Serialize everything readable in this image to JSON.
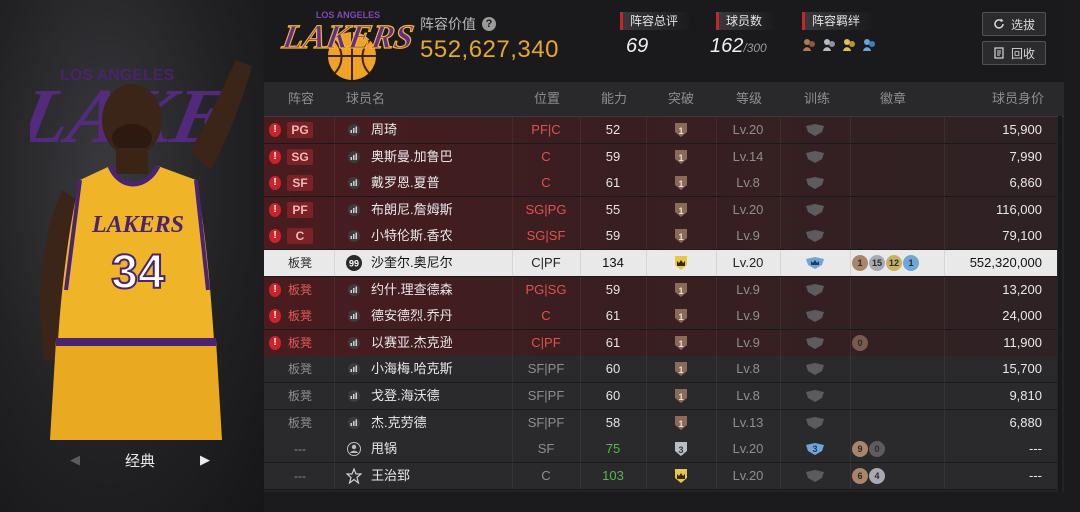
{
  "left_panel": {
    "era_label": "经典",
    "jersey_team": "LAKERS",
    "jersey_number": "34"
  },
  "header": {
    "logo_text_top": "LOS ANGELES",
    "logo_text_main": "LAKERS",
    "value_label": "阵容价值",
    "value_amount": "552,627,340",
    "stats": {
      "overall_label": "阵容总评",
      "overall_value": "69",
      "players_label": "球员数",
      "players_value": "162",
      "players_max": "/300",
      "bonds_label": "阵容羁绊"
    },
    "select_button": "选拔",
    "recycle_button": "回收"
  },
  "columns": {
    "slot": "阵容",
    "name": "球员名",
    "position": "位置",
    "rating": "能力",
    "breakthrough": "突破",
    "level": "等级",
    "training": "训练",
    "badges": "徽章",
    "price": "球员身价"
  },
  "rows": [
    {
      "warn": true,
      "slot": "PG",
      "slot_style": "badge",
      "icon": "bars",
      "name": "周琦",
      "pos": "PF|C",
      "rating": "52",
      "rating_color": "normal",
      "break": "1",
      "break_type": "brown",
      "level": "Lv.20",
      "train": "gray",
      "badges": [],
      "price": "15,900"
    },
    {
      "warn": true,
      "slot": "SG",
      "slot_style": "badge",
      "icon": "bars",
      "name": "奥斯曼.加鲁巴",
      "pos": "C",
      "rating": "59",
      "rating_color": "normal",
      "break": "1",
      "break_type": "brown",
      "level": "Lv.14",
      "train": "gray",
      "badges": [],
      "price": "7,990"
    },
    {
      "warn": true,
      "slot": "SF",
      "slot_style": "badge",
      "icon": "bars",
      "name": "戴罗恩.夏普",
      "pos": "C",
      "rating": "61",
      "rating_color": "normal",
      "break": "1",
      "break_type": "brown",
      "level": "Lv.8",
      "train": "gray",
      "badges": [],
      "price": "6,860"
    },
    {
      "warn": true,
      "slot": "PF",
      "slot_style": "badge",
      "icon": "bars",
      "name": "布朗尼.詹姆斯",
      "pos": "SG|PG",
      "rating": "55",
      "rating_color": "normal",
      "break": "1",
      "break_type": "brown",
      "level": "Lv.20",
      "train": "gray",
      "badges": [],
      "price": "116,000"
    },
    {
      "warn": true,
      "slot": "C",
      "slot_style": "badge",
      "icon": "bars",
      "name": "小特伦斯.香农",
      "pos": "SG|SF",
      "rating": "59",
      "rating_color": "normal",
      "break": "1",
      "break_type": "brown",
      "level": "Lv.9",
      "train": "gray",
      "badges": [],
      "price": "79,100"
    },
    {
      "warn": false,
      "selected": true,
      "slot": "板凳",
      "slot_style": "text",
      "icon": "rating99",
      "icon_text": "99",
      "name": "沙奎尔.奥尼尔",
      "pos": "C|PF",
      "rating": "134",
      "rating_color": "normal",
      "break": "crown",
      "break_type": "gold",
      "level": "Lv.20",
      "train": "blue",
      "badges": [
        {
          "t": "1",
          "c": "#a9856b"
        },
        {
          "t": "15",
          "c": "#a7aab0"
        },
        {
          "t": "12",
          "c": "#c9b067"
        },
        {
          "t": "1",
          "c": "#6fa6d6"
        }
      ],
      "price": "552,320,000"
    },
    {
      "warn": true,
      "slot": "板凳",
      "slot_style": "text",
      "icon": "bars",
      "name": "约什.理查德森",
      "pos": "PG|SG",
      "rating": "59",
      "rating_color": "normal",
      "break": "1",
      "break_type": "brown",
      "level": "Lv.9",
      "train": "gray",
      "badges": [],
      "price": "13,200"
    },
    {
      "warn": true,
      "slot": "板凳",
      "slot_style": "text",
      "icon": "bars",
      "name": "德安德烈.乔丹",
      "pos": "C",
      "rating": "61",
      "rating_color": "normal",
      "break": "1",
      "break_type": "brown",
      "level": "Lv.9",
      "train": "gray",
      "badges": [],
      "price": "24,000"
    },
    {
      "warn": true,
      "slot": "板凳",
      "slot_style": "text",
      "icon": "bars",
      "name": "以赛亚.杰克逊",
      "pos": "C|PF",
      "rating": "61",
      "rating_color": "normal",
      "break": "1",
      "break_type": "brown",
      "level": "Lv.9",
      "train": "gray",
      "badges": [
        {
          "t": "0",
          "c": "#7a5a4a"
        }
      ],
      "price": "11,900"
    },
    {
      "warn": false,
      "slot": "板凳",
      "slot_style": "text",
      "icon": "bars",
      "name": "小海梅.哈克斯",
      "pos": "SF|PF",
      "rating": "60",
      "rating_color": "normal",
      "break": "1",
      "break_type": "brown",
      "level": "Lv.8",
      "train": "gray",
      "badges": [],
      "price": "15,700"
    },
    {
      "warn": false,
      "slot": "板凳",
      "slot_style": "text",
      "icon": "bars",
      "name": "戈登.海沃德",
      "pos": "SF|PF",
      "rating": "60",
      "rating_color": "normal",
      "break": "1",
      "break_type": "brown",
      "level": "Lv.8",
      "train": "gray",
      "badges": [],
      "price": "9,810"
    },
    {
      "warn": false,
      "slot": "板凳",
      "slot_style": "text",
      "icon": "bars",
      "name": "杰.克劳德",
      "pos": "SF|PF",
      "rating": "58",
      "rating_color": "normal",
      "break": "1",
      "break_type": "brown",
      "level": "Lv.13",
      "train": "gray",
      "badges": [],
      "price": "6,880"
    },
    {
      "warn": false,
      "slot": "---",
      "slot_style": "text",
      "icon": "person",
      "name": "甩锅",
      "pos": "SF",
      "rating": "75",
      "rating_color": "green",
      "break": "3",
      "break_type": "silver",
      "level": "Lv.20",
      "train": "blue3",
      "train_text": "3",
      "badges": [
        {
          "t": "9",
          "c": "#a9856b"
        },
        {
          "t": "0",
          "c": "#5c5c5e"
        }
      ],
      "price": "---"
    },
    {
      "warn": false,
      "slot": "---",
      "slot_style": "text",
      "icon": "star",
      "name": "王治郅",
      "pos": "C",
      "rating": "103",
      "rating_color": "green",
      "break": "crown",
      "break_type": "gold",
      "level": "Lv.20",
      "train": "gray",
      "badges": [
        {
          "t": "6",
          "c": "#a9856b"
        },
        {
          "t": "4",
          "c": "#a7aab0"
        }
      ],
      "price": "---"
    }
  ],
  "colors": {
    "accent_gold": "#e6a72e",
    "warn_red": "#c8242a",
    "lakers_purple": "#552583",
    "lakers_gold": "#f5b427"
  }
}
